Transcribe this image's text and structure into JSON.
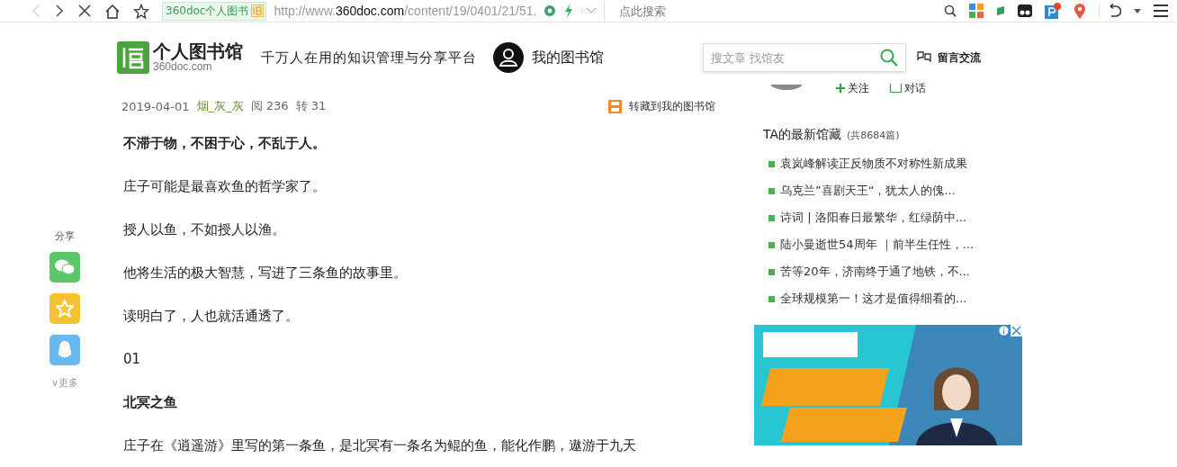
{
  "browser": {
    "back_disabled": true,
    "site_tag": "360doc个人图书",
    "url_host_prefix": "http://www.",
    "url_host": "360doc.com",
    "url_path": "/content/19/0401/21/51.",
    "search": {
      "placeholder": "点此搜索"
    }
  },
  "header": {
    "logo_title": "个人图书馆",
    "logo_domain": "360doc.com",
    "slogan": "千万人在用的知识管理与分享平台",
    "my_library": "我的图书馆",
    "search": {
      "placeholder": "搜文章 找馆友"
    },
    "message": "留言交流"
  },
  "meta": {
    "date": "2019-04-01",
    "author": "烟_灰_灰",
    "reads": "阅 236",
    "reposts": "转 31",
    "save": "转藏到我的图书馆"
  },
  "share": {
    "label": "分享",
    "more": "∨更多"
  },
  "paragraphs": [
    {
      "kind": "bold",
      "text": "不滞于物，不困于心，不乱于人。"
    },
    {
      "kind": "text",
      "text": "庄子可能是最喜欢鱼的哲学家了。"
    },
    {
      "kind": "text",
      "text": "授人以鱼，不如授人以渔。"
    },
    {
      "kind": "text",
      "text": "他将生活的极大智慧，写进了三条鱼的故事里。"
    },
    {
      "kind": "text",
      "text": "读明白了，人也就活通透了。"
    },
    {
      "kind": "text",
      "text": "01"
    },
    {
      "kind": "bold",
      "text": "北冥之鱼"
    },
    {
      "kind": "text",
      "text": "庄子在《逍遥游》里写的第一条鱼，是北冥有一条名为鲲的鱼，能化作鹏，遨游于九天"
    }
  ],
  "sidebar": {
    "follow": "关注",
    "talk": "对话",
    "latest_title": "TA的最新馆藏",
    "latest_count": "(共8684篇)",
    "latest": [
      "袁岚峰解读正反物质不对称性新成果",
      "乌克兰”喜剧天王“，犹太人的傀...",
      "诗词 | 洛阳春日最繁华，红绿荫中...",
      "陆小曼逝世54周年 ｜前半生任性，...",
      "苦等20年，济南终于通了地铁，不...",
      "全球规模第一！这才是值得细看的..."
    ]
  }
}
